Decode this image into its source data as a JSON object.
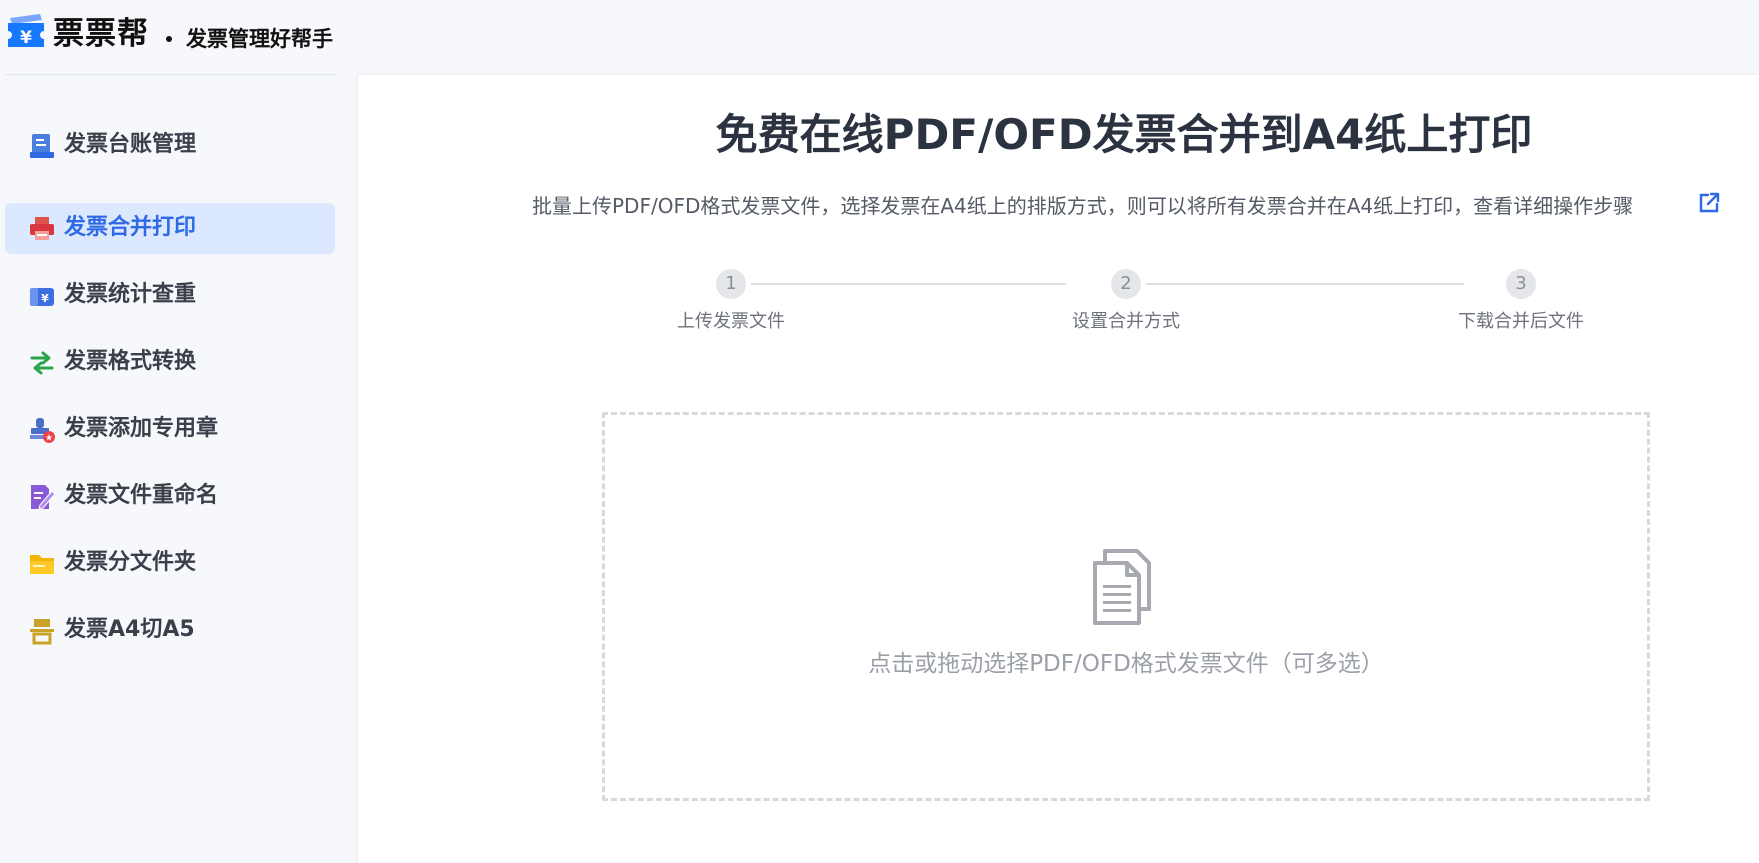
{
  "header": {
    "brand_name": "票票帮",
    "slogan": "发票管理好帮手",
    "logo_icon": "ticket-yen-icon"
  },
  "sidebar": {
    "items": [
      {
        "label": "发票台账管理",
        "icon": "ledger-icon",
        "active": false
      },
      {
        "label": "发票合并打印",
        "icon": "printer-icon",
        "active": true
      },
      {
        "label": "发票统计查重",
        "icon": "stats-wallet-icon",
        "active": false
      },
      {
        "label": "发票格式转换",
        "icon": "convert-arrows-icon",
        "active": false
      },
      {
        "label": "发票添加专用章",
        "icon": "stamp-icon",
        "active": false
      },
      {
        "label": "发票文件重命名",
        "icon": "edit-document-icon",
        "active": false
      },
      {
        "label": "发票分文件夹",
        "icon": "folder-icon",
        "active": false
      },
      {
        "label": "发票A4切A5",
        "icon": "cut-page-icon",
        "active": false
      }
    ]
  },
  "main": {
    "title": "免费在线PDF/OFD发票合并到A4纸上打印",
    "description": "批量上传PDF/OFD格式发票文件，选择发票在A4纸上的排版方式，则可以将所有发票合并在A4纸上打印，查看详细操作步骤",
    "steps": [
      {
        "number": "1",
        "label": "上传发票文件"
      },
      {
        "number": "2",
        "label": "设置合并方式"
      },
      {
        "number": "3",
        "label": "下载合并后文件"
      }
    ],
    "upload": {
      "hint": "点击或拖动选择PDF/OFD格式发票文件（可多选）",
      "icon": "documents-icon"
    }
  },
  "colors": {
    "accent": "#2f6ae6",
    "active_bg": "#dbe8fd",
    "logo_blue": "#1677ff"
  }
}
